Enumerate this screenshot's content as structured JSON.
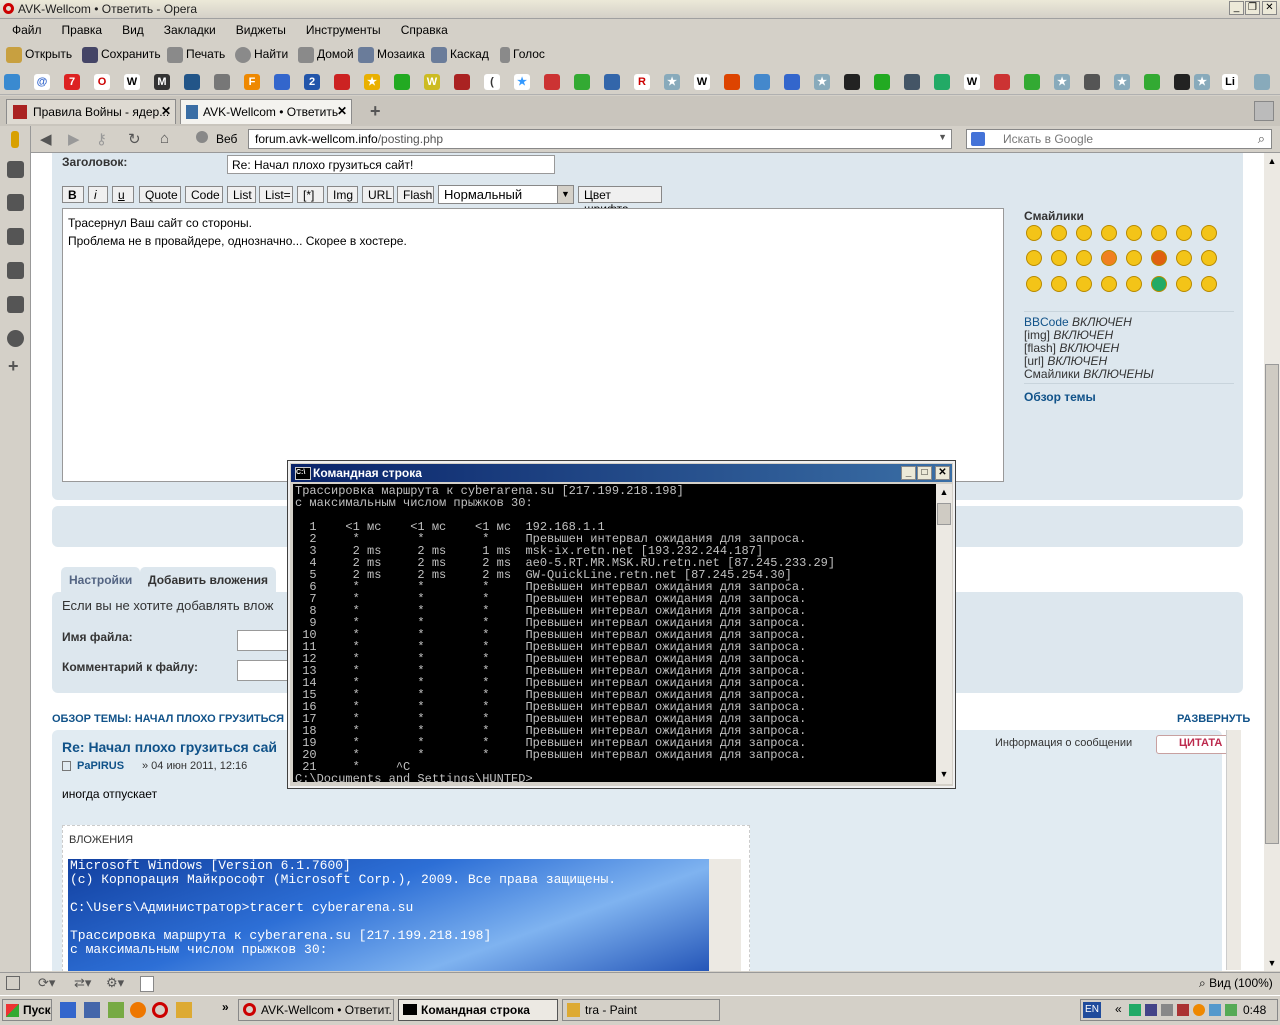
{
  "window": {
    "title": "AVK-Wellcom • Ответить - Opera"
  },
  "menu": [
    "Файл",
    "Правка",
    "Вид",
    "Закладки",
    "Виджеты",
    "Инструменты",
    "Справка"
  ],
  "toolbar": {
    "open": "Открыть",
    "save": "Сохранить",
    "print": "Печать",
    "find": "Найти",
    "home": "Домой",
    "mosaic": "Мозаика",
    "cascade": "Каскад",
    "voice": "Голос"
  },
  "tabs": [
    {
      "label": "Правила Войны - ядер..."
    },
    {
      "label": "AVK-Wellcom • Ответить"
    }
  ],
  "address": {
    "web_label": "Веб",
    "url_host": "forum.avk-wellcom.info",
    "url_path": "/posting.php",
    "search_placeholder": "Искать в Google"
  },
  "form": {
    "subject_label": "Заголовок:",
    "subject_value": "Re: Начал плохо грузиться сайт!",
    "bbcode_buttons": [
      "B",
      "i",
      "u",
      "Quote",
      "Code",
      "List",
      "List=",
      "[*]",
      "Img",
      "URL",
      "Flash"
    ],
    "font_size_value": "Нормальный",
    "font_color_button": "Цвет шрифта",
    "message_lines": "Трасернул Ваш сайт со стороны.\nПроблема не в провайдере, однозначно... Скорее в хостере."
  },
  "sidebar": {
    "smilies_title": "Смайлики",
    "bbcode_label": "BBCode",
    "bbcode_state": "ВКЛЮЧЕН",
    "img_label": "[img]",
    "img_state": "ВКЛЮЧЕН",
    "flash_label": "[flash]",
    "flash_state": "ВКЛЮЧЕН",
    "url_label": "[url]",
    "url_state": "ВКЛЮЧЕН",
    "smilies_label": "Смайлики",
    "smilies_state": "ВКЛЮЧЕНЫ",
    "topic_review": "Обзор темы"
  },
  "attach": {
    "tab_settings": "Настройки",
    "tab_add": "Добавить вложения",
    "info": "Если вы не хотите добавлять влож",
    "filename_label": "Имя файла:",
    "comment_label": "Комментарий к файлу:"
  },
  "review": {
    "header": "ОБЗОР ТЕМЫ: НАЧАЛ ПЛОХО ГРУЗИТЬСЯ САЙ",
    "expand": "РАЗВЕРНУТЬ",
    "post_title": "Re: Начал плохо грузиться сай",
    "author": "PaPIRUS",
    "date": "» 04 июн 2011, 12:16",
    "info_link": "Информация о сообщении",
    "quote_btn": "ЦИТАТА",
    "body": "иногда отпускает",
    "attach_label": "ВЛОЖЕНИЯ",
    "attach_text": "Microsoft Windows [Version 6.1.7600]\n(с) Корпорация Майкрософт (Microsoft Corp.), 2009. Все права защищены.\n\nC:\\Users\\Администратор>tracert cyberarena.su\n\nТрассировка маршрута к cyberarena.su [217.199.218.198]\nс максимальным числом прыжков 30:"
  },
  "cmd": {
    "title": "Командная строка",
    "output": "Трассировка маршрута к cyberarena.su [217.199.218.198]\nс максимальным числом прыжков 30:\n\n  1    <1 мс    <1 мс    <1 мс  192.168.1.1\n  2     *        *        *     Превышен интервал ожидания для запроса.\n  3     2 ms     2 ms     1 ms  msk-ix.retn.net [193.232.244.187]\n  4     2 ms     2 ms     2 ms  ae0-5.RT.MR.MSK.RU.retn.net [87.245.233.29]\n  5     2 ms     2 ms     2 ms  GW-QuickLine.retn.net [87.245.254.30]\n  6     *        *        *     Превышен интервал ожидания для запроса.\n  7     *        *        *     Превышен интервал ожидания для запроса.\n  8     *        *        *     Превышен интервал ожидания для запроса.\n  9     *        *        *     Превышен интервал ожидания для запроса.\n 10     *        *        *     Превышен интервал ожидания для запроса.\n 11     *        *        *     Превышен интервал ожидания для запроса.\n 12     *        *        *     Превышен интервал ожидания для запроса.\n 13     *        *        *     Превышен интервал ожидания для запроса.\n 14     *        *        *     Превышен интервал ожидания для запроса.\n 15     *        *        *     Превышен интервал ожидания для запроса.\n 16     *        *        *     Превышен интервал ожидания для запроса.\n 17     *        *        *     Превышен интервал ожидания для запроса.\n 18     *        *        *     Превышен интервал ожидания для запроса.\n 19     *        *        *     Превышен интервал ожидания для запроса.\n 20     *        *        *     Превышен интервал ожидания для запроса.\n 21     *     ^C\nC:\\Documents and Settings\\HUNTED>"
  },
  "status": {
    "zoom": "Вид (100%)"
  },
  "taskbar": {
    "start": "Пуск",
    "tasks": [
      "AVK-Wellcom • Ответит...",
      "Командная строка",
      "tra - Paint"
    ],
    "lang": "EN",
    "clock": "0:48"
  },
  "colors": {
    "accent": "#0a246a",
    "link": "#105289",
    "panel": "#dde7ee",
    "opera_red": "#cc0000"
  }
}
